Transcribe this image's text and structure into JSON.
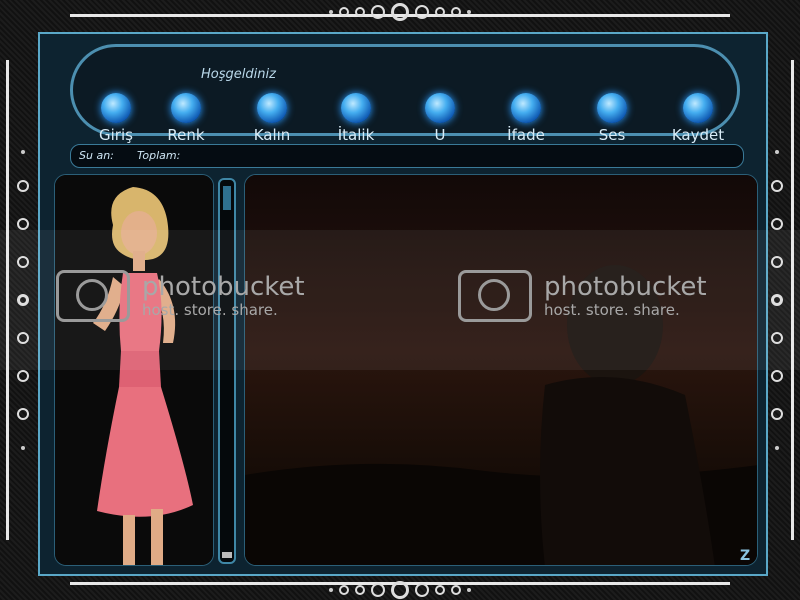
{
  "header": {
    "welcome": "Hoşgeldiniz"
  },
  "toolbar": {
    "buttons": [
      {
        "label": "Giriş"
      },
      {
        "label": "Renk"
      },
      {
        "label": "Kalın"
      },
      {
        "label": "İtalik"
      },
      {
        "label": "U"
      },
      {
        "label": "İfade"
      },
      {
        "label": "Ses"
      },
      {
        "label": "Kaydet"
      }
    ]
  },
  "status": {
    "now_label": "Su an:",
    "total_label": "Toplam:"
  },
  "watermark": {
    "brand": "photobucket",
    "tagline": "host. store. share."
  },
  "corner": {
    "mark": "Z"
  },
  "colors": {
    "accent": "#5aa8c8",
    "orb": "#45aef0",
    "dress": "#e8707e"
  }
}
